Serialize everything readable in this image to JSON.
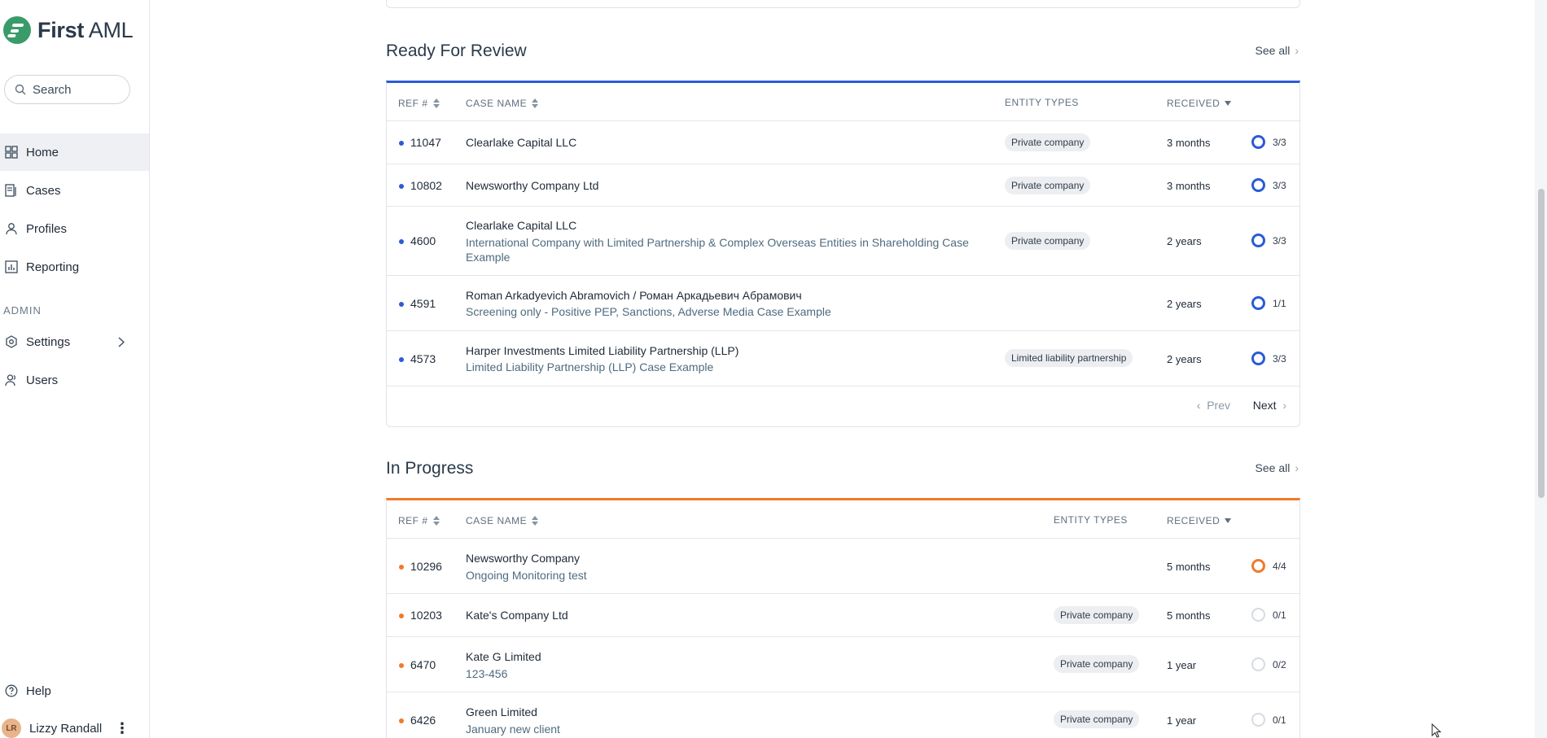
{
  "app": {
    "logo_bold": "First",
    "logo_light": "AML",
    "search_placeholder": "Search"
  },
  "sidebar": {
    "items": [
      {
        "label": "Home",
        "icon": "grid-icon",
        "active": true
      },
      {
        "label": "Cases",
        "icon": "cases-icon"
      },
      {
        "label": "Profiles",
        "icon": "person-icon"
      },
      {
        "label": "Reporting",
        "icon": "chart-icon"
      }
    ],
    "admin_label": "ADMIN",
    "admin_items": [
      {
        "label": "Settings",
        "icon": "gear-icon"
      },
      {
        "label": "Users",
        "icon": "users-icon"
      }
    ],
    "help_label": "Help",
    "user": {
      "initials": "LR",
      "name": "Lizzy Randall"
    }
  },
  "ready_for_review": {
    "title": "Ready For Review",
    "see_all": "See all",
    "headers": {
      "ref": "REF #",
      "case_name": "CASE NAME",
      "entity_types": "ENTITY TYPES",
      "received": "RECEIVED"
    },
    "rows": [
      {
        "ref": "11047",
        "name": "Clearlake Capital LLC",
        "sub": "",
        "entity": "Private company",
        "received": "3 months",
        "progress": "3/3"
      },
      {
        "ref": "10802",
        "name": "Newsworthy Company Ltd",
        "sub": "",
        "entity": "Private company",
        "received": "3 months",
        "progress": "3/3"
      },
      {
        "ref": "4600",
        "name": "Clearlake Capital LLC",
        "sub": "International Company with Limited Partnership & Complex Overseas Entities in Shareholding Case Example",
        "entity": "Private company",
        "received": "2 years",
        "progress": "3/3"
      },
      {
        "ref": "4591",
        "name": "Roman Arkadyevich Abramovich / Роман Аркадьевич Абрамович",
        "sub": "Screening only - Positive PEP, Sanctions, Adverse Media Case Example",
        "entity": "",
        "received": "2 years",
        "progress": "1/1"
      },
      {
        "ref": "4573",
        "name": "Harper Investments Limited Liability Partnership (LLP)",
        "sub": "Limited Liability Partnership (LLP) Case Example",
        "entity": "Limited liability partnership",
        "received": "2 years",
        "progress": "3/3"
      }
    ],
    "prev": "Prev",
    "next": "Next"
  },
  "in_progress": {
    "title": "In Progress",
    "see_all": "See all",
    "headers": {
      "ref": "REF #",
      "case_name": "CASE NAME",
      "entity_types": "ENTITY TYPES",
      "received": "RECEIVED"
    },
    "rows": [
      {
        "ref": "10296",
        "name": "Newsworthy Company",
        "sub": "Ongoing Monitoring test",
        "entity": "",
        "received": "5 months",
        "progress": "4/4",
        "complete": true
      },
      {
        "ref": "10203",
        "name": "Kate's Company Ltd",
        "sub": "",
        "entity": "Private company",
        "received": "5 months",
        "progress": "0/1",
        "complete": false
      },
      {
        "ref": "6470",
        "name": "Kate G Limited",
        "sub": "123-456",
        "entity": "Private company",
        "received": "1 year",
        "progress": "0/2",
        "complete": false
      },
      {
        "ref": "6426",
        "name": "Green Limited",
        "sub": "January new client",
        "entity": "Private company",
        "received": "1 year",
        "progress": "0/1",
        "complete": false
      }
    ]
  },
  "colors": {
    "review_accent": "#2a5bd7",
    "progress_accent": "#f07a2a",
    "brand": "#3a9b6a"
  }
}
